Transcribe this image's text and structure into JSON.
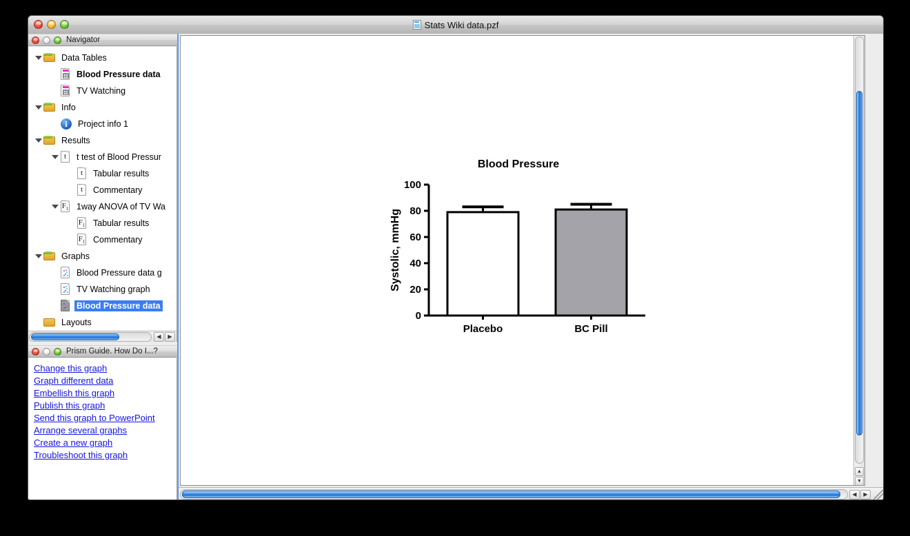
{
  "window": {
    "title": "Stats Wiki data.pzf",
    "doc_icon": "prism-document-icon",
    "close_label": "close",
    "minimize_label": "minimize",
    "zoom_label": "zoom"
  },
  "navigator": {
    "panel_title": "Navigator",
    "tree": [
      {
        "label": "Data Tables",
        "level": 0,
        "icon": "folder-icon",
        "expanded": true,
        "selected": false,
        "bold": false
      },
      {
        "label": "Blood Pressure data",
        "level": 1,
        "icon": "data-table-icon",
        "expanded": null,
        "selected": false,
        "bold": true
      },
      {
        "label": "TV Watching",
        "level": 1,
        "icon": "data-table-icon",
        "expanded": null,
        "selected": false,
        "bold": false
      },
      {
        "label": "Info",
        "level": 0,
        "icon": "folder-icon",
        "expanded": true,
        "selected": false,
        "bold": false
      },
      {
        "label": "Project info 1",
        "level": 1,
        "icon": "info-icon",
        "expanded": null,
        "selected": false,
        "bold": false
      },
      {
        "label": "Results",
        "level": 0,
        "icon": "folder-icon",
        "expanded": true,
        "selected": false,
        "bold": false
      },
      {
        "label": "t test of Blood Pressur",
        "level": 1,
        "icon": "t-test-icon",
        "expanded": true,
        "selected": false,
        "bold": false
      },
      {
        "label": "Tabular results",
        "level": 2,
        "icon": "t-test-icon",
        "expanded": null,
        "selected": false,
        "bold": false
      },
      {
        "label": "Commentary",
        "level": 2,
        "icon": "t-test-icon",
        "expanded": null,
        "selected": false,
        "bold": false
      },
      {
        "label": "1way ANOVA of TV Wa",
        "level": 1,
        "icon": "anova-icon",
        "expanded": true,
        "selected": false,
        "bold": false
      },
      {
        "label": "Tabular results",
        "level": 2,
        "icon": "anova-icon",
        "expanded": null,
        "selected": false,
        "bold": false
      },
      {
        "label": "Commentary",
        "level": 2,
        "icon": "anova-icon",
        "expanded": null,
        "selected": false,
        "bold": false
      },
      {
        "label": "Graphs",
        "level": 0,
        "icon": "folder-icon",
        "expanded": true,
        "selected": false,
        "bold": false
      },
      {
        "label": "Blood Pressure data g",
        "level": 1,
        "icon": "graph-icon",
        "expanded": null,
        "selected": false,
        "bold": false
      },
      {
        "label": "TV Watching graph",
        "level": 1,
        "icon": "graph-icon",
        "expanded": null,
        "selected": false,
        "bold": false
      },
      {
        "label": "Blood Pressure data",
        "level": 1,
        "icon": "graph-icon",
        "expanded": null,
        "selected": true,
        "bold": true
      },
      {
        "label": "Layouts",
        "level": 0,
        "icon": "folder-icon-plain",
        "expanded": null,
        "selected": false,
        "bold": false
      }
    ]
  },
  "guide": {
    "panel_title": "Prism Guide. How Do I...?",
    "links": [
      "Change this graph",
      "Graph different data",
      "Embellish this graph",
      "Publish this graph",
      "Send this graph to PowerPoint",
      "Arrange several graphs",
      "Create a new graph",
      "Troubleshoot this graph"
    ]
  },
  "scrollbars": {
    "left_arrow": "◀",
    "right_arrow": "▶",
    "up_arrow": "▲",
    "down_arrow": "▼"
  },
  "chart_data": {
    "type": "bar",
    "title": "Blood Pressure",
    "xlabel": "",
    "ylabel": "Systolic, mmHg",
    "categories": [
      "Placebo",
      "BC Pill"
    ],
    "values": [
      79,
      81
    ],
    "errors": [
      4,
      4
    ],
    "bar_colors": [
      "#ffffff",
      "#a3a3a9"
    ],
    "bar_edge_color": "#000000",
    "ylim": [
      0,
      100
    ],
    "yticks": [
      0,
      20,
      40,
      60,
      80,
      100
    ],
    "grid": false,
    "legend": "none"
  }
}
